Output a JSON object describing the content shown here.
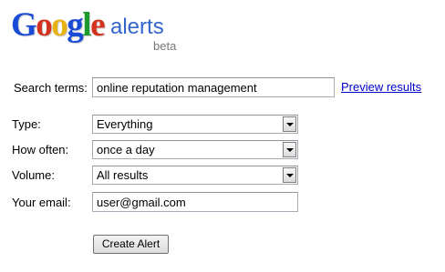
{
  "logo": {
    "letters": [
      {
        "char": "G",
        "color": "#1a4bd6"
      },
      {
        "char": "o",
        "color": "#d3321e"
      },
      {
        "char": "o",
        "color": "#e8b312"
      },
      {
        "char": "g",
        "color": "#1a4bd6"
      },
      {
        "char": "l",
        "color": "#1c9a2e"
      },
      {
        "char": "e",
        "color": "#d3321e"
      }
    ],
    "product": "alerts",
    "badge": "beta"
  },
  "form": {
    "search_terms": {
      "label": "Search terms:",
      "value": "online reputation management"
    },
    "preview_link": "Preview results",
    "type": {
      "label": "Type:",
      "selected": "Everything"
    },
    "how_often": {
      "label": "How often:",
      "selected": "once a day"
    },
    "volume": {
      "label": "Volume:",
      "selected": "All results"
    },
    "email": {
      "label": "Your email:",
      "value": "user@gmail.com"
    },
    "submit_label": "Create Alert"
  },
  "icons": {
    "dropdown": "chevron-down-icon"
  }
}
